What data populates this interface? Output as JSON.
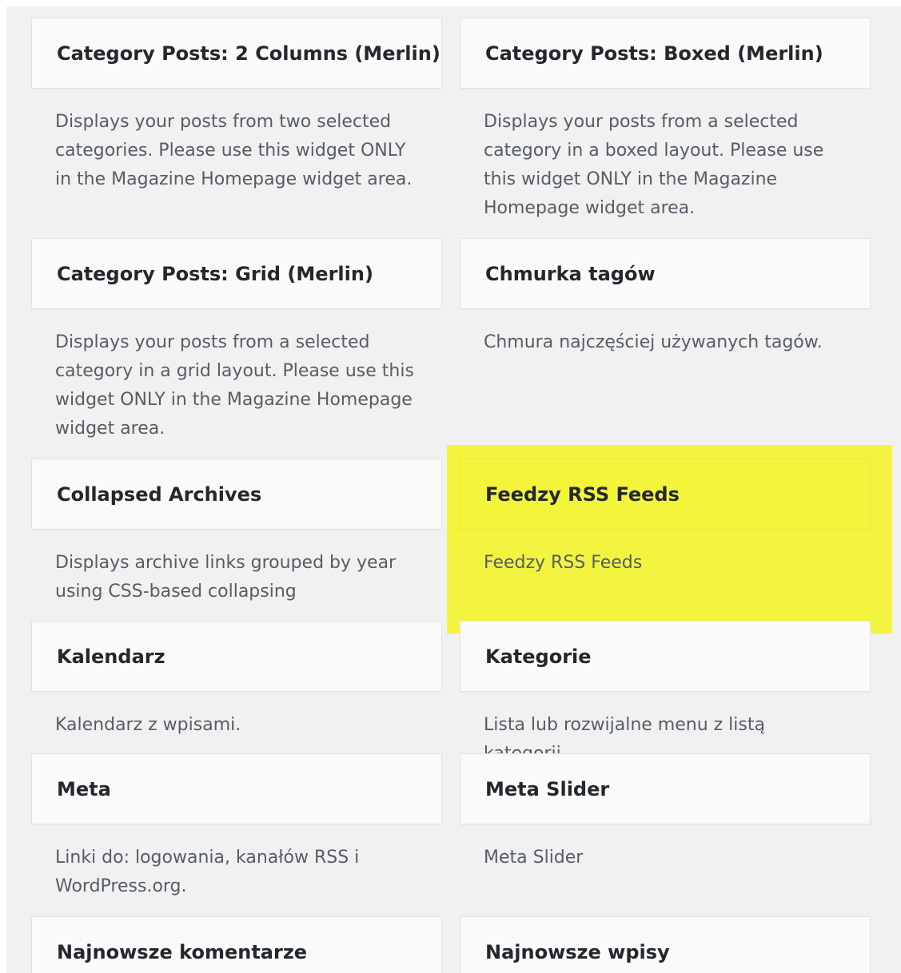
{
  "highlight_color": "#f3f43f",
  "widgets": [
    {
      "title": "Category Posts: 2 Columns (Merlin)",
      "description": "Displays your posts from two selected categories. Please use this widget ONLY in the Magazine Homepage widget area."
    },
    {
      "title": "Category Posts: Boxed (Merlin)",
      "description": "Displays your posts from a selected category in a boxed layout. Please use this widget ONLY in the Magazine Homepage widget area."
    },
    {
      "title": "Category Posts: Grid (Merlin)",
      "description": "Displays your posts from a selected category in a grid layout. Please use this widget ONLY in the Magazine Homepage widget area."
    },
    {
      "title": "Chmurka tagów",
      "description": "Chmura najczęściej używanych tagów."
    },
    {
      "title": "Collapsed Archives",
      "description": "Displays archive links grouped by year using CSS-based collapsing"
    },
    {
      "title": "Feedzy RSS Feeds",
      "description": "Feedzy RSS Feeds",
      "highlighted": true
    },
    {
      "title": "Kalendarz",
      "description": "Kalendarz z wpisami."
    },
    {
      "title": "Kategorie",
      "description": "Lista lub rozwijalne menu z listą kategorii"
    },
    {
      "title": "Meta",
      "description": "Linki do: logowania, kanałów RSS i WordPress.org."
    },
    {
      "title": "Meta Slider",
      "description": "Meta Slider"
    },
    {
      "title": "Najnowsze komentarze",
      "description": ""
    },
    {
      "title": "Najnowsze wpisy",
      "description": ""
    }
  ]
}
